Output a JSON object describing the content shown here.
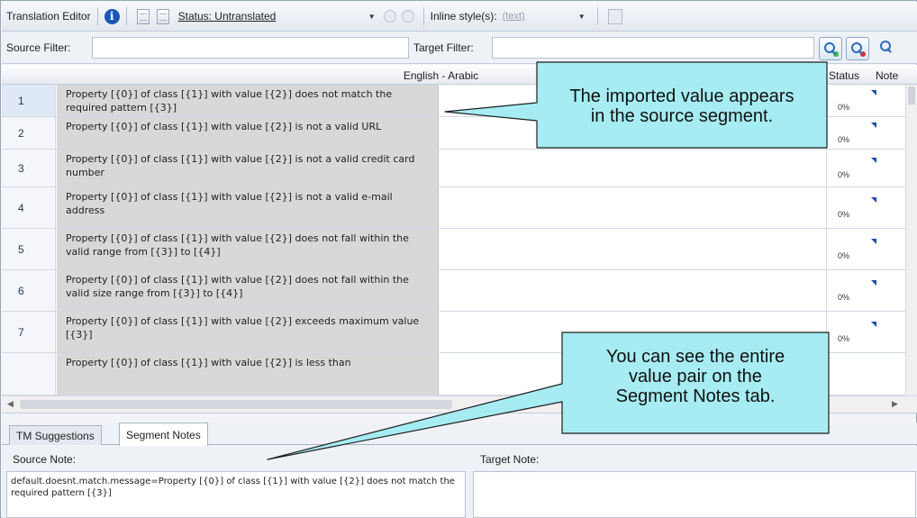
{
  "toolbar": {
    "title": "Translation Editor",
    "status_label": "Status: Untranslated",
    "inline_label": "Inline style(s):",
    "inline_value": "(text)"
  },
  "filters": {
    "source_label": "Source Filter:",
    "target_label": "Target Filter:"
  },
  "grid": {
    "language_header": "English - Arabic",
    "status_header": "Status",
    "note_header": "Note",
    "rows": [
      {
        "num": "1",
        "source": "Property [{0}] of class [{1}] with value [{2}] does not match the required pattern [{3}]",
        "status": "0%"
      },
      {
        "num": "2",
        "source": "Property [{0}] of class [{1}] with value [{2}] is not a valid URL",
        "status": "0%"
      },
      {
        "num": "3",
        "source": "Property [{0}] of class [{1}] with value [{2}] is not a valid credit card number",
        "status": "0%"
      },
      {
        "num": "4",
        "source": "Property [{0}] of class [{1}] with value [{2}] is not a valid e-mail address",
        "status": "0%"
      },
      {
        "num": "5",
        "source": "Property [{0}] of class [{1}] with value [{2}] does not fall within the valid range from [{3}] to [{4}]",
        "status": "0%"
      },
      {
        "num": "6",
        "source": "Property [{0}] of class [{1}] with value [{2}] does not fall within the valid size range from [{3}] to [{4}]",
        "status": "0%"
      },
      {
        "num": "7",
        "source": "Property [{0}] of class [{1}] with value [{2}] exceeds maximum value [{3}]",
        "status": "0%"
      },
      {
        "num": "",
        "source": "Property [{0}] of class [{1}] with value [{2}] is less than",
        "status": ""
      }
    ]
  },
  "tabs": {
    "tm_suggestions": "TM Suggestions",
    "segment_notes": "Segment Notes"
  },
  "notes": {
    "source_label": "Source Note:",
    "target_label": "Target Note:",
    "source_text": "default.doesnt.match.message=Property [{0}] of class [{1}] with value [{2}] does not match the required pattern [{3}]"
  },
  "callouts": {
    "top_line1": "The imported value appears",
    "top_line2": "in the source segment.",
    "bottom_line1": "You can see the entire",
    "bottom_line2": "value pair on the",
    "bottom_line3": "Segment Notes tab."
  },
  "colors": {
    "callout_fill": "#a6ecf2",
    "source_cell": "#d8d8d8",
    "note_icon": "#1d4fa6"
  },
  "icons": [
    "info-icon",
    "document-icon",
    "toggle-icon",
    "paste-icon",
    "search-icon",
    "search-clear-icon",
    "search-options-icon",
    "note-icon"
  ]
}
